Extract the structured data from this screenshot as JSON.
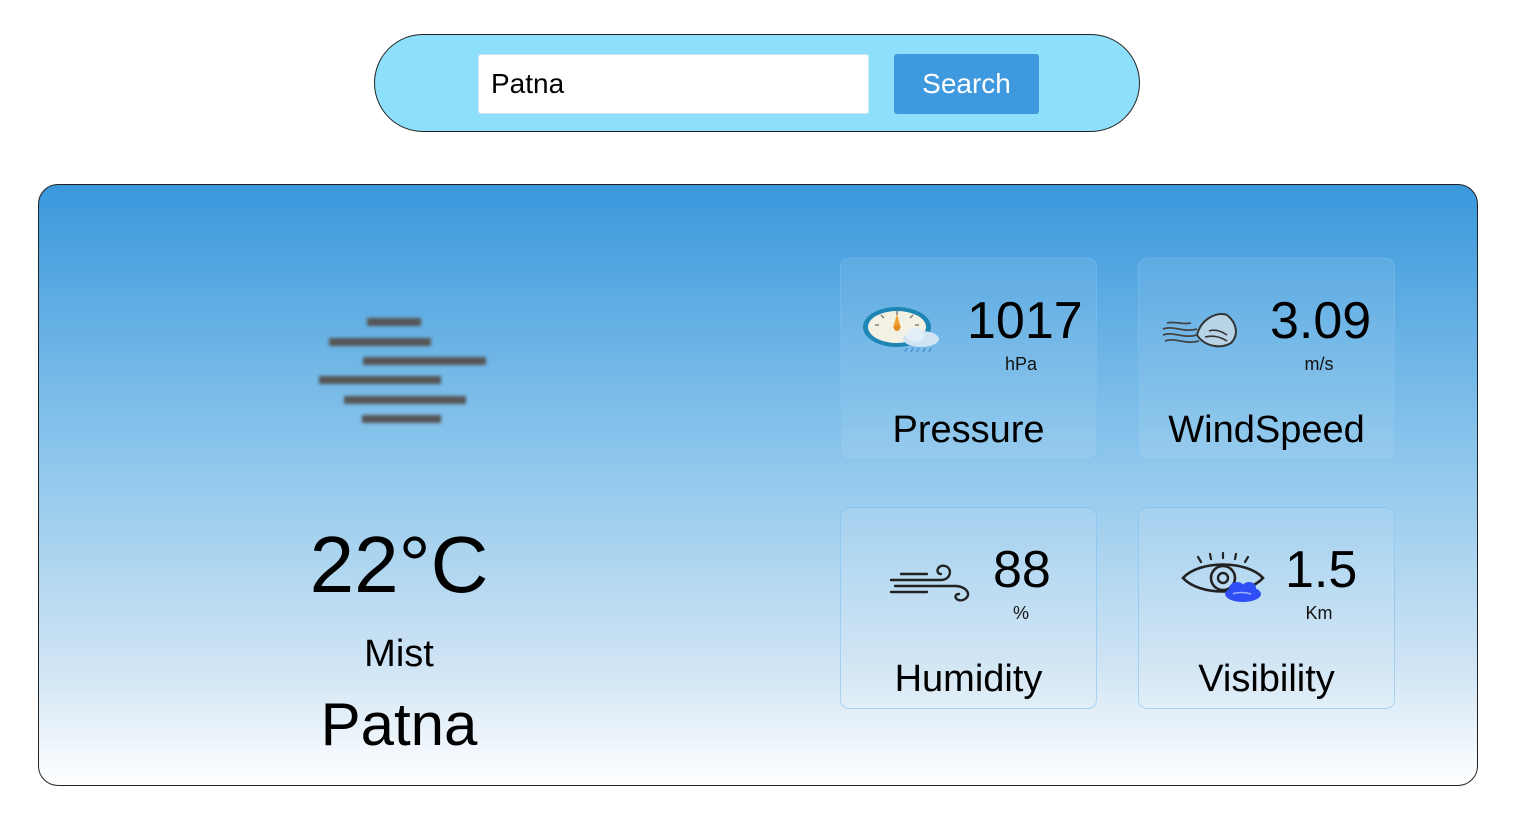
{
  "search": {
    "value": "Patna",
    "button_label": "Search"
  },
  "weather": {
    "temperature": "22°C",
    "condition": "Mist",
    "city": "Patna",
    "condition_icon": "mist-icon"
  },
  "stats": {
    "pressure": {
      "value": "1017",
      "unit": "hPa",
      "label": "Pressure",
      "icon": "pressure-gauge-icon"
    },
    "windspeed": {
      "value": "3.09",
      "unit": "m/s",
      "label": "WindSpeed",
      "icon": "wind-icon"
    },
    "humidity": {
      "value": "88",
      "unit": "%",
      "label": "Humidity",
      "icon": "humidity-icon"
    },
    "visibility": {
      "value": "1.5",
      "unit": "Km",
      "label": "Visibility",
      "icon": "visibility-eye-icon"
    }
  },
  "colors": {
    "search_bar_bg": "#8ddffb",
    "search_button_bg": "#3f99de",
    "card_gradient_top": "#3a98dc",
    "card_gradient_bottom": "#ffffff"
  }
}
